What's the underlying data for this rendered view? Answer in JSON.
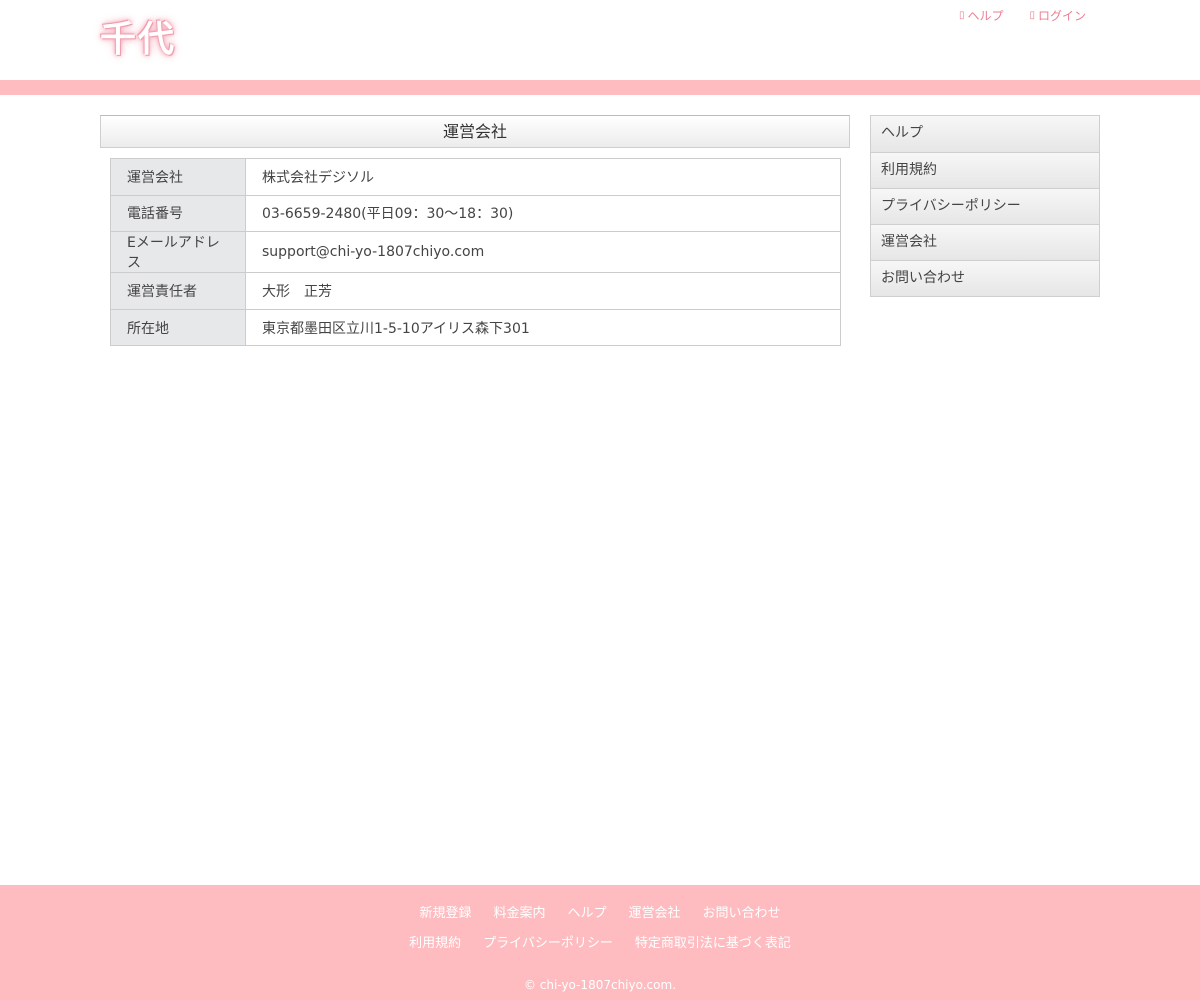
{
  "header": {
    "logo_text": "千代",
    "links": [
      {
        "icon": "help-icon",
        "label": "ヘルプ"
      },
      {
        "icon": "login-icon",
        "label": "ログイン"
      }
    ]
  },
  "main": {
    "title": "運営会社",
    "rows": [
      {
        "label": "運営会社",
        "value": "株式会社デジソル"
      },
      {
        "label": "電話番号",
        "value": "03-6659-2480(平日09：30〜18：30)"
      },
      {
        "label": "Eメールアドレス",
        "value": "support@chi-yo-1807chiyo.com"
      },
      {
        "label": "運営責任者",
        "value": "大形　正芳"
      },
      {
        "label": "所在地",
        "value": "東京都墨田区立川1-5-10アイリス森下301"
      }
    ]
  },
  "sidebar": {
    "items": [
      {
        "label": "ヘルプ"
      },
      {
        "label": "利用規約"
      },
      {
        "label": "プライバシーポリシー"
      },
      {
        "label": "運営会社"
      },
      {
        "label": "お問い合わせ"
      }
    ]
  },
  "footer": {
    "row1": [
      {
        "label": "新規登録"
      },
      {
        "label": "料金案内"
      },
      {
        "label": "ヘルプ"
      },
      {
        "label": "運営会社"
      },
      {
        "label": "お問い合わせ"
      }
    ],
    "row2": [
      {
        "label": "利用規約"
      },
      {
        "label": "プライバシーポリシー"
      },
      {
        "label": "特定商取引法に基づく表記"
      }
    ],
    "copyright": "© chi-yo-1807chiyo.com."
  },
  "colors": {
    "accent_pink": "#ffbcc0",
    "link_pink": "#e97f93"
  }
}
